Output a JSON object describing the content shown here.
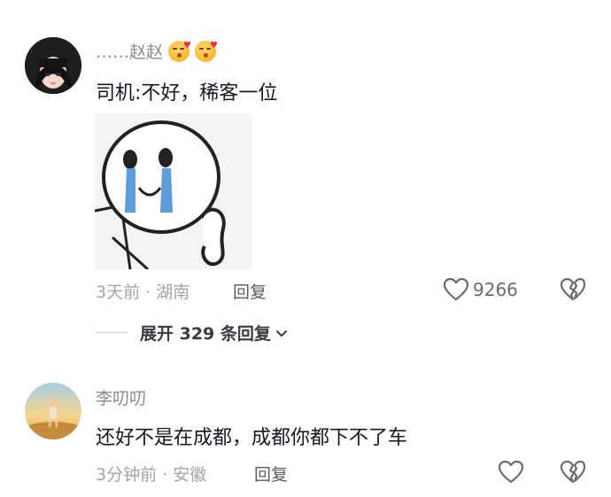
{
  "comments": [
    {
      "username": "……赵赵",
      "emojis": [
        "kiss-face-emoji",
        "kiss-face-emoji"
      ],
      "text": "司机:不好，稀客一位",
      "sticker": "crying-meme-sticker",
      "time_location": "3天前 · 湖南",
      "reply_label": "回复",
      "like_count": "9266",
      "expand_label": "展开 329 条回复"
    },
    {
      "username": "李叨叨",
      "text": "还好不是在成都，成都你都下不了车",
      "time_location": "3分钟前 · 安徽",
      "reply_label": "回复"
    }
  ],
  "colors": {
    "username": "#8a8b91",
    "meta": "#a3a4a9",
    "text": "#161823"
  }
}
